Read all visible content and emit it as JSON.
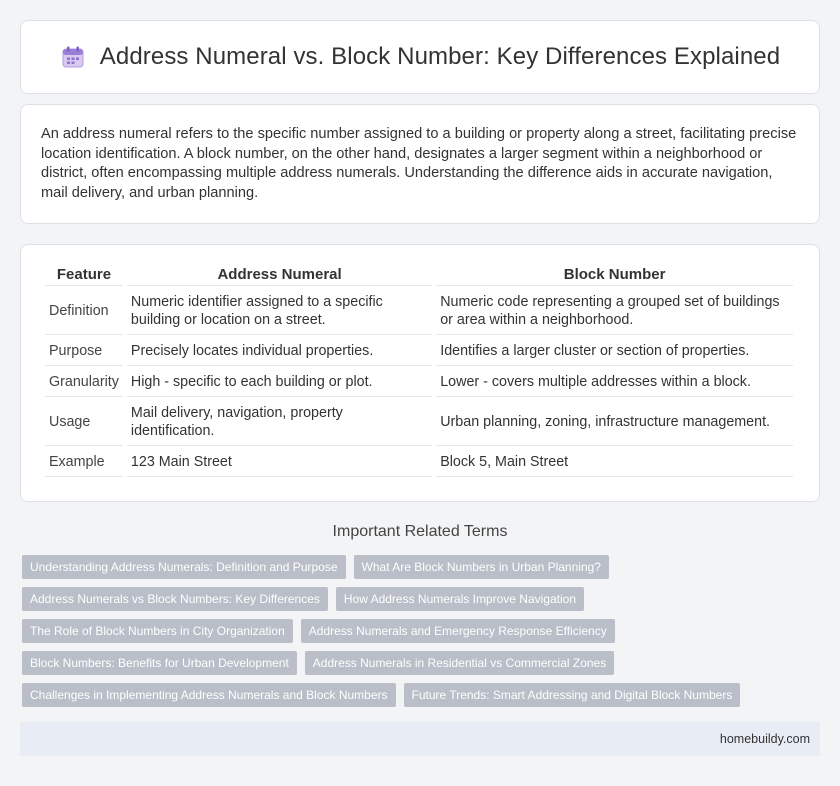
{
  "header": {
    "title": "Address Numeral vs. Block Number: Key Differences Explained",
    "icon": "calendar-icon"
  },
  "intro": {
    "text": "An address numeral refers to the specific number assigned to a building or property along a street, facilitating precise location identification. A block number, on the other hand, designates a larger segment within a neighborhood or district, often encompassing multiple address numerals. Understanding the difference aids in accurate navigation, mail delivery, and urban planning."
  },
  "table": {
    "headers": [
      "Feature",
      "Address Numeral",
      "Block Number"
    ],
    "rows": [
      [
        "Definition",
        "Numeric identifier assigned to a specific building or location on a street.",
        "Numeric code representing a grouped set of buildings or area within a neighborhood."
      ],
      [
        "Purpose",
        "Precisely locates individual properties.",
        "Identifies a larger cluster or section of properties."
      ],
      [
        "Granularity",
        "High - specific to each building or plot.",
        "Lower - covers multiple addresses within a block."
      ],
      [
        "Usage",
        "Mail delivery, navigation, property identification.",
        "Urban planning, zoning, infrastructure management."
      ],
      [
        "Example",
        "123 Main Street",
        "Block 5, Main Street"
      ]
    ]
  },
  "related": {
    "title": "Important Related Terms",
    "tags": [
      "Understanding Address Numerals: Definition and Purpose",
      "What Are Block Numbers in Urban Planning?",
      "Address Numerals vs Block Numbers: Key Differences",
      "How Address Numerals Improve Navigation",
      "The Role of Block Numbers in City Organization",
      "Address Numerals and Emergency Response Efficiency",
      "Block Numbers: Benefits for Urban Development",
      "Address Numerals in Residential vs Commercial Zones",
      "Challenges in Implementing Address Numerals and Block Numbers",
      "Future Trends: Smart Addressing and Digital Block Numbers"
    ]
  },
  "footer": {
    "site": "homebuildy.com"
  },
  "colors": {
    "background": "#f3f4f6",
    "tag": "#b9bec8",
    "footer": "#e7ecf5"
  }
}
